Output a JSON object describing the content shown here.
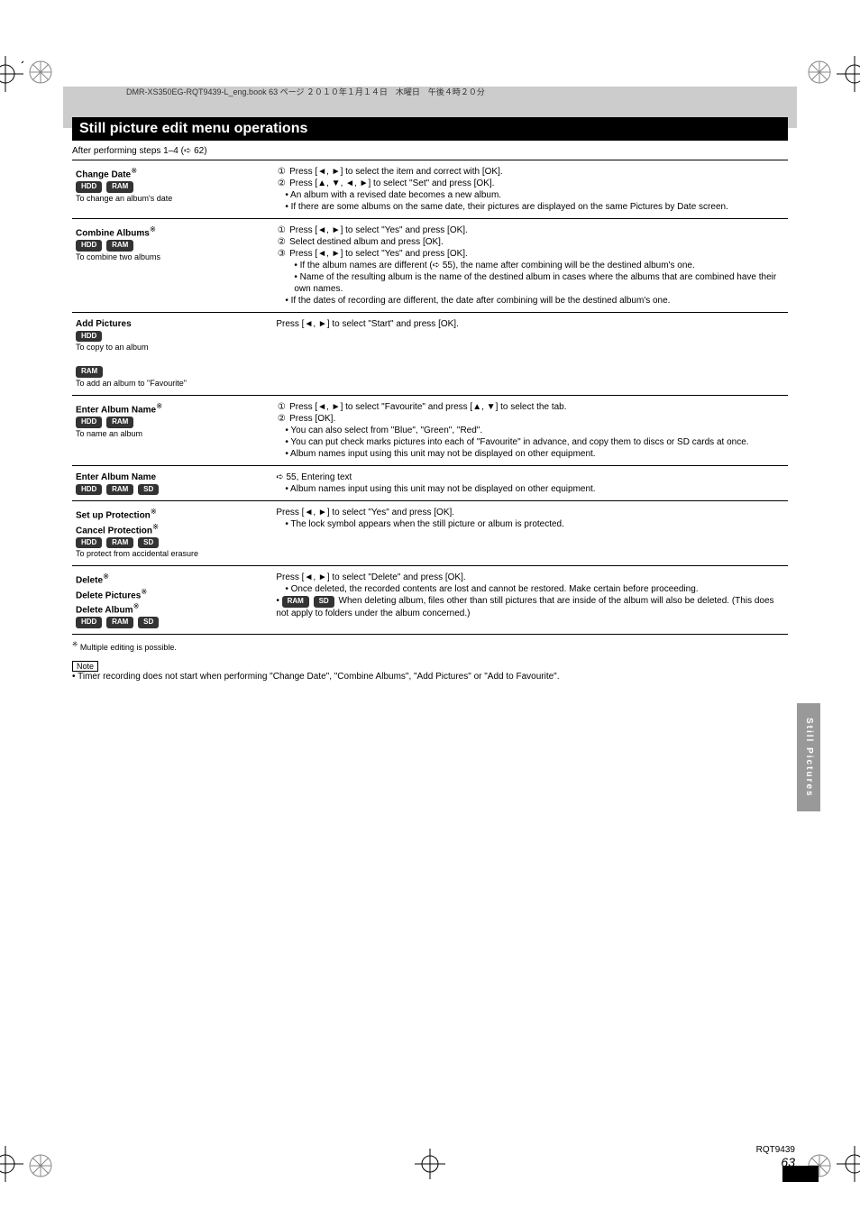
{
  "header_line": "DMR-XS350EG-RQT9439-L_eng.book  63 ページ  ２０１０年１月１４日　木曜日　午後４時２０分",
  "title": "Still picture edit menu operations",
  "intro_prefix": "After performing steps 1–4 (",
  "intro_page_ref": "➪ 62)",
  "discs": {
    "hdd": "HDD",
    "ram": "RAM",
    "sd": "SD"
  },
  "rows": [
    {
      "name": "Change Date",
      "sup": "※",
      "sub": "To change an album's date",
      "discs": [
        "hdd",
        "ram"
      ],
      "right": {
        "items": [
          {
            "num": "①",
            "text_before": "Press [",
            "arrow": "lr",
            "text_after": "] to select the item and correct with [OK]."
          },
          {
            "num": "②",
            "text_before": "Press [",
            "arrow": "udlr",
            "text_after": "] to select \"Set\" and press [OK]."
          }
        ],
        "bullets": [
          "An album with a revised date becomes a new album.",
          "If there are some albums on the same date, their pictures are displayed on the same Pictures by Date screen."
        ]
      }
    },
    {
      "name": "Combine Albums",
      "sup": "※",
      "sub": "To combine two albums",
      "discs": [
        "hdd",
        "ram"
      ],
      "right": {
        "items": [
          {
            "num": "①",
            "text_before": "Press [",
            "arrow": "lr",
            "text_after": "] to select \"Yes\" and press [OK]."
          },
          {
            "num": "②",
            "plain": "Select destined album and press [OK]."
          },
          {
            "num": "③",
            "text_before": "Press [",
            "arrow": "lr",
            "text_after": "] to select \"Yes\" and press [OK]."
          }
        ],
        "bullets": [
          "If the album names are different (➪ 55), the name after combining will be the destined album's one.",
          "Name of the resulting album is the name of the destined album in cases where the albums that are combined have their own names.",
          "If the dates of recording are different, the date after combining will be the destined album's one."
        ]
      }
    },
    {
      "name": "Add Pictures",
      "sub_hdd": "To copy to an album",
      "sub_ram": "To add an album to \"Favourite\"",
      "discs_top": [
        "hdd"
      ],
      "discs_bottom": [
        "ram"
      ],
      "right": {
        "plain_before": "Press [",
        "arrow": "lr",
        "plain_after": "] to select \"Start\" and press [OK]."
      }
    },
    {
      "name": "Enter Album Name",
      "sup": "※",
      "sub": "To name an album",
      "discs": [
        "hdd",
        "ram"
      ],
      "right": {
        "items": [
          {
            "num": "①",
            "text_before": "Press [",
            "arrow": "lr",
            "text_after": "] to select \"Favourite\" and press [",
            "arrow2": "ud",
            "text_after2": "] to select the tab."
          },
          {
            "num": "②",
            "plain": "Press [OK]."
          }
        ],
        "bullets": [
          "You can also select from \"Blue\", \"Green\", \"Red\".",
          "You can put check marks pictures into each of \"Favourite\" in advance, and copy them to discs or SD cards at once.",
          "Album names input using this unit may not be displayed on other equipment."
        ]
      }
    },
    {
      "name": "Enter Album Name",
      "discs": [
        "hdd",
        "ram",
        "sd"
      ],
      "right": {
        "plain_line": "➪ 55, Entering text",
        "bullets": [
          "Album names input using this unit may not be displayed on other equipment."
        ]
      }
    },
    {
      "name": "Set up Protection",
      "sup": "※",
      "name2": "Cancel Protection",
      "sup2": "※",
      "sub": "To protect from accidental erasure",
      "discs": [
        "hdd",
        "ram",
        "sd"
      ],
      "right": {
        "plain_before": "Press [",
        "arrow": "lr",
        "plain_after": "] to select \"Yes\" and press [OK].",
        "bullets": [
          "The lock symbol appears when the still picture or album is protected."
        ]
      }
    },
    {
      "name": "Delete",
      "sup": "※",
      "name2": "Delete Pictures",
      "sup2": "※",
      "name3": "Delete Album",
      "sup3": "※",
      "discs": [
        "hdd",
        "ram",
        "sd"
      ],
      "right": {
        "plain_before": "Press [",
        "arrow": "lr",
        "plain_after": "] to select \"Delete\" and press [OK].",
        "bullets": [
          "Once deleted, the recorded contents are lost and cannot be restored. Make certain before proceeding."
        ],
        "extra_discs": [
          "ram",
          "sd"
        ],
        "extra_text": "When deleting album, files other than still pictures that are inside of the album will also be deleted. (This does not apply to folders under the album concerned.)"
      }
    }
  ],
  "footnote_sup": "※",
  "footnote": "Multiple editing is possible.",
  "note_label": "Note",
  "note_text": "Timer recording does not start when performing \"Change Date\", \"Combine Albums\", \"Add Pictures\" or \"Add to Favourite\".",
  "side_tab": "Still Pictures",
  "footer_label": "RQT9439",
  "footer_page": "63"
}
